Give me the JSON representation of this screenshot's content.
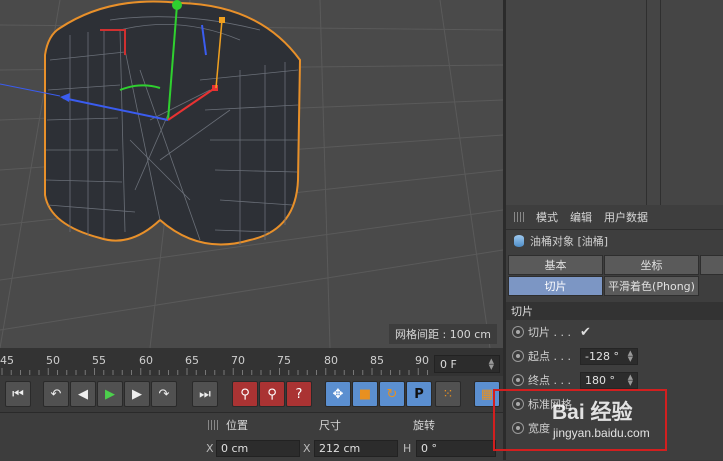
{
  "viewport": {
    "grid_spacing_label": "网格间距 : 100 cm"
  },
  "attributes": {
    "menu": [
      "模式",
      "编辑",
      "用户数据"
    ],
    "object_title": "油桶对象 [油桶]",
    "tabs": [
      {
        "label": "基本",
        "active": false
      },
      {
        "label": "坐标",
        "active": false
      },
      {
        "label": "切片",
        "active": true
      },
      {
        "label": "平滑着色(Phong)",
        "active": false
      }
    ],
    "section_title": "切片",
    "rows": [
      {
        "label": "切片 . . .",
        "value": "✔",
        "kind": "check"
      },
      {
        "label": "起点 . . .",
        "value": "-128 °",
        "kind": "field"
      },
      {
        "label": "终点 . . .",
        "value": "180 °",
        "kind": "field"
      },
      {
        "label": "标准网格",
        "value": "",
        "kind": "field"
      },
      {
        "label": "宽度",
        "value": "",
        "kind": "field"
      }
    ]
  },
  "timeline": {
    "ticks": [
      "45",
      "50",
      "55",
      "60",
      "65",
      "70",
      "75",
      "80",
      "85",
      "90"
    ],
    "current_frame": "0 F"
  },
  "transport": {
    "buttons": [
      {
        "name": "go-to-start-button",
        "glyph": "⏮"
      },
      {
        "name": "previous-key-button",
        "glyph": "↶"
      },
      {
        "name": "previous-frame-button",
        "glyph": "◀"
      },
      {
        "name": "play-button",
        "glyph": "▶"
      },
      {
        "name": "next-frame-button",
        "glyph": "▶"
      },
      {
        "name": "next-key-button",
        "glyph": "↷"
      },
      {
        "name": "go-to-end-button",
        "glyph": "⏭"
      },
      {
        "name": "record-keys-button",
        "glyph": "⚲"
      },
      {
        "name": "auto-key-button",
        "glyph": "⚲"
      },
      {
        "name": "key-help-button",
        "glyph": "?"
      },
      {
        "name": "move-key-button",
        "glyph": "✥"
      },
      {
        "name": "scale-key-button",
        "glyph": "■"
      },
      {
        "name": "rotate-key-button",
        "glyph": "↻"
      },
      {
        "name": "parameter-key-button",
        "glyph": "P"
      },
      {
        "name": "point-level-button",
        "glyph": "⁙"
      },
      {
        "name": "film-button",
        "glyph": "▦"
      }
    ]
  },
  "coordinates": {
    "headers": [
      "位置",
      "尺寸",
      "旋转"
    ],
    "fields": [
      {
        "axis": "X",
        "value": "0 cm"
      },
      {
        "axis": "X",
        "value": "212 cm"
      },
      {
        "axis": "H",
        "value": "0 °"
      }
    ]
  },
  "watermark": {
    "brand": "Bai 经验",
    "url": "jingyan.baidu.com"
  }
}
